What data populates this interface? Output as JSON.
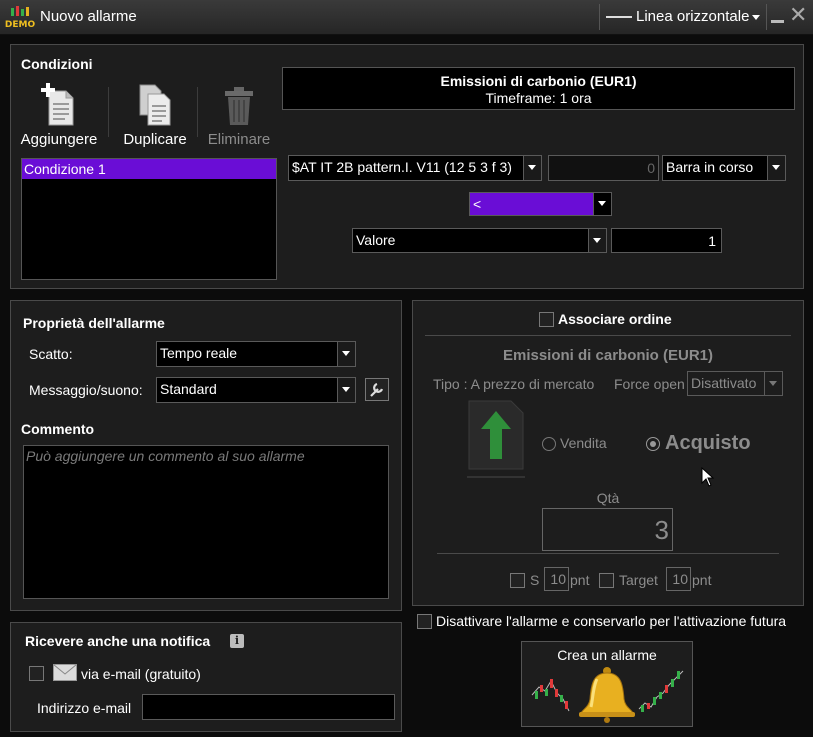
{
  "window": {
    "logo_text": "DEMO",
    "title": "Nuovo allarme",
    "line_type": "Linea orizzontale"
  },
  "conditions": {
    "header": "Condizioni",
    "toolbar": {
      "add": "Aggiungere",
      "duplicate": "Duplicare",
      "delete": "Eliminare"
    },
    "instrument": {
      "name": "Emissioni di carbonio (EUR1)",
      "timeframe": "Timeframe: 1 ora"
    },
    "list": [
      "Condizione 1"
    ],
    "indicator": "$AT IT 2B pattern.I. V11 (12 5 3 f 3)",
    "offset": "0",
    "bar": "Barra in corso",
    "operator": "<",
    "compare_type": "Valore",
    "compare_value": "1"
  },
  "properties": {
    "header": "Proprietà dell'allarme",
    "trigger_label": "Scatto:",
    "trigger_value": "Tempo reale",
    "message_label": "Messaggio/suono:",
    "message_value": "Standard",
    "comment_header": "Commento",
    "comment_placeholder": "Può aggiungere un commento al suo allarme"
  },
  "notify": {
    "header": "Ricevere anche una notifica",
    "info_symbol": "i",
    "email_option": "via e-mail (gratuito)",
    "email_label": "Indirizzo e-mail",
    "email_value": ""
  },
  "order": {
    "associate_label": "Associare ordine",
    "instrument": "Emissioni di carbonio (EUR1)",
    "type_label": "Tipo : A prezzo di mercato",
    "force_open_label": "Force open",
    "force_open_value": "Disattivato",
    "sell_label": "Vendita",
    "buy_label": "Acquisto",
    "qty_label": "Qtà",
    "qty_value": "3",
    "stop_label": "S",
    "stop_value": "10",
    "stop_unit": "pnt",
    "target_label": "Target",
    "target_value": "10",
    "target_unit": "pnt"
  },
  "footer": {
    "disable_label": "Disattivare l'allarme e conservarlo per l'attivazione futura",
    "create_label": "Crea un allarme"
  },
  "colors": {
    "accent": "#6a0dd6",
    "panel": "#1d1d1d",
    "border": "#4a4a4a",
    "bell": "#e8b020",
    "candle_up": "#35b04a",
    "candle_down": "#e03a3a"
  },
  "icons": {
    "add": "document-plus-icon",
    "duplicate": "documents-icon",
    "delete": "trash-icon",
    "wrench": "wrench-icon",
    "mail": "envelope-icon",
    "arrow": "green-up-arrow-icon",
    "bell": "bell-icon"
  }
}
